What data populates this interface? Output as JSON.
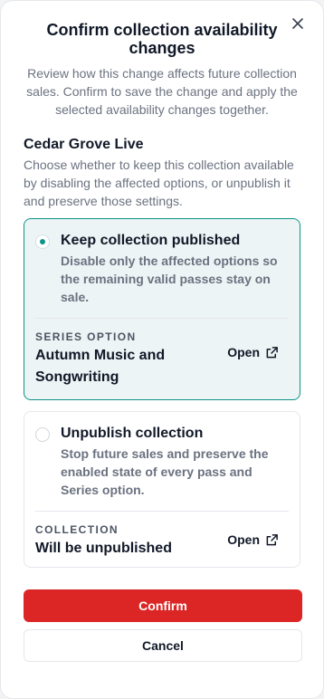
{
  "dialog": {
    "title": "Confirm collection availability changes",
    "intro": "Review how this change affects future collection sales. Confirm to save the change and apply the selected availability changes together."
  },
  "collection": {
    "name": "Cedar Grove Live",
    "description": "Choose whether to keep this collection available by disabling the affected options, or unpublish it and preserve those settings."
  },
  "options": [
    {
      "title": "Keep collection published",
      "description": "Disable only the affected options so the remaining valid passes stay on sale.",
      "selected": true,
      "footer_label": "SERIES OPTION",
      "footer_value": "Autumn Music and Songwriting",
      "link": "Open"
    },
    {
      "title": "Unpublish collection",
      "description": "Stop future sales and preserve the enabled state of every pass and Series option.",
      "selected": false,
      "footer_label": "COLLECTION",
      "footer_value": "Will be unpublished",
      "link": "Open"
    }
  ],
  "actions": {
    "confirm": "Confirm",
    "cancel": "Cancel"
  },
  "colors": {
    "accent": "#0d9488",
    "danger": "#dc2626"
  },
  "icons": {
    "close": "close-icon",
    "external": "external-link-icon"
  }
}
